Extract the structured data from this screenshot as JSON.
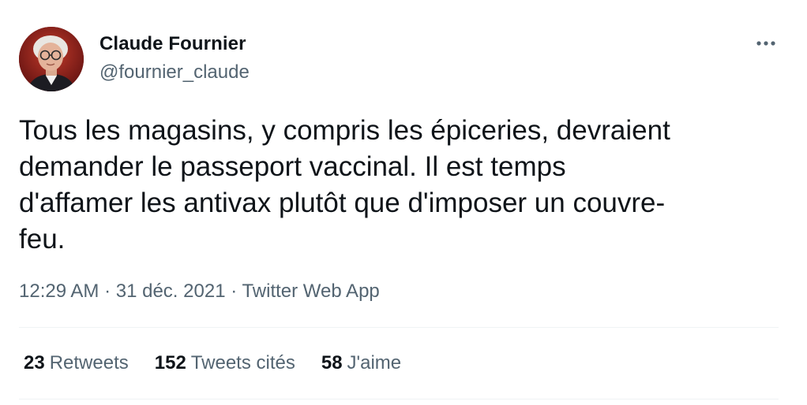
{
  "author": {
    "name": "Claude Fournier",
    "handle": "@fournier_claude",
    "avatar_icon": "profile-photo"
  },
  "more_icon": "more-horizontal-icon",
  "tweet": {
    "text": "Tous les magasins, y compris les épiceries, devraient\ndemander le passeport vaccinal. Il est temps\nd'affamer les antivax plutôt que d'imposer un couvre-\nfeu."
  },
  "meta": {
    "time": "12:29 AM",
    "separator1": "·",
    "date": "31 déc. 2021",
    "separator2": "·",
    "source": "Twitter Web App"
  },
  "stats": [
    {
      "count": "23",
      "label": "Retweets"
    },
    {
      "count": "152",
      "label": "Tweets cités"
    },
    {
      "count": "58",
      "label": "J'aime"
    }
  ],
  "colors": {
    "text_primary": "#0f1419",
    "text_secondary": "#536471",
    "divider": "#eff3f4"
  }
}
